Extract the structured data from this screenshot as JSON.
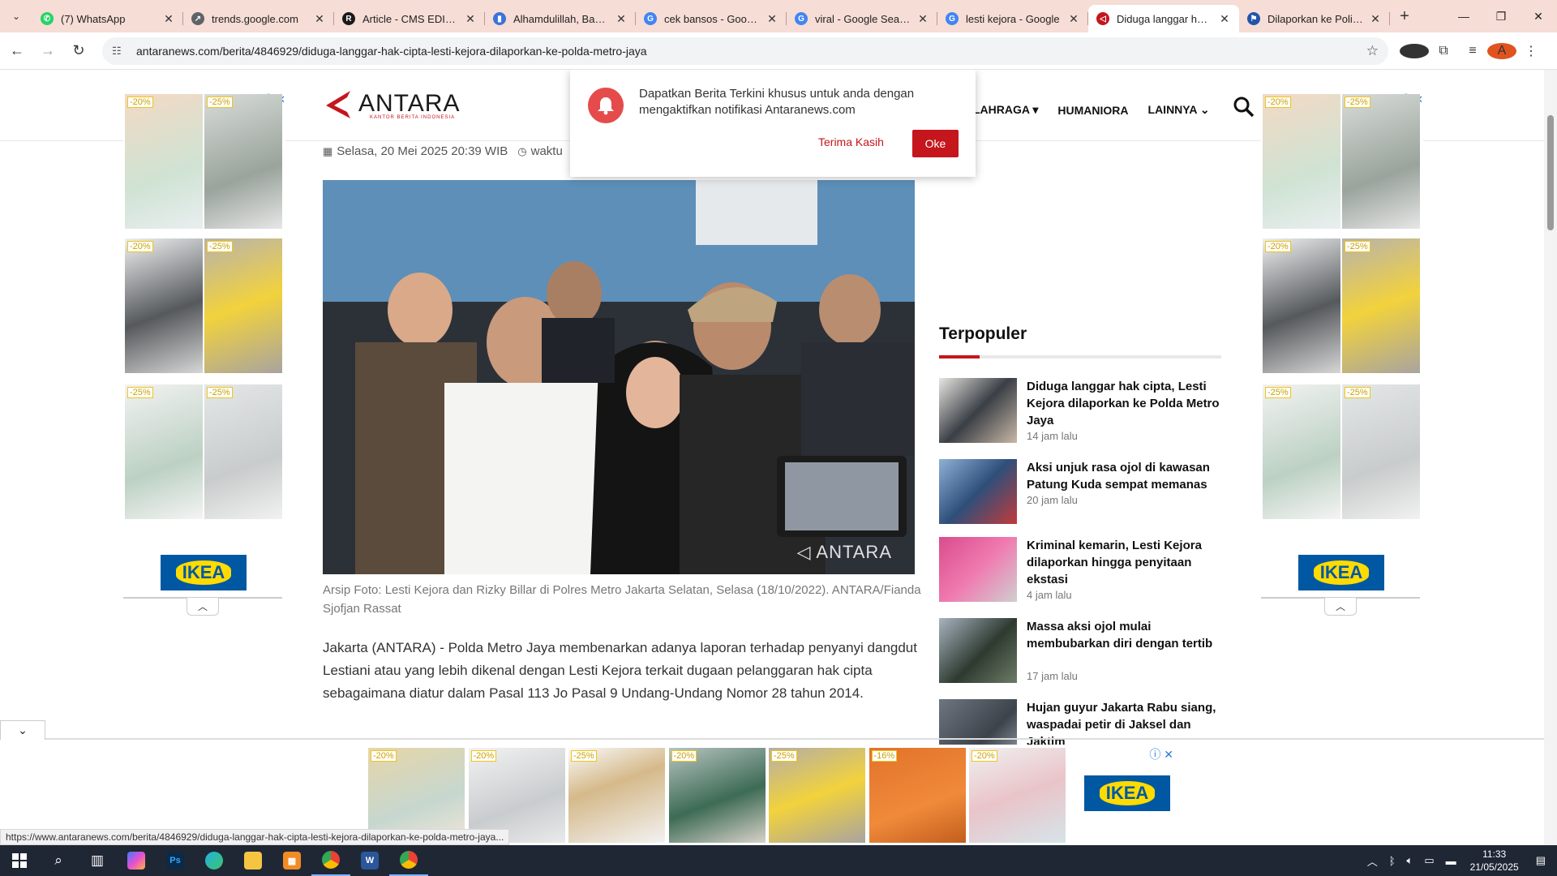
{
  "browser": {
    "tabs": [
      {
        "title": "(7) WhatsApp",
        "color": "#25d366",
        "glyph": "✆"
      },
      {
        "title": "trends.google.com",
        "color": "#5f6368",
        "glyph": "↗"
      },
      {
        "title": "Article - CMS EDITOR",
        "color": "#1a1a1a",
        "glyph": "R"
      },
      {
        "title": "Alhamdulillah, Bansos",
        "color": "#3b73d9",
        "glyph": "▮"
      },
      {
        "title": "cek bansos - Google",
        "color": "#4285f4",
        "glyph": "G"
      },
      {
        "title": "viral - Google Search",
        "color": "#4285f4",
        "glyph": "G"
      },
      {
        "title": "lesti kejora - Google",
        "color": "#4285f4",
        "glyph": "G"
      },
      {
        "title": "Diduga langgar hak c",
        "color": "#c4161c",
        "glyph": "◁"
      },
      {
        "title": "Dilaporkan ke Polisi, I",
        "color": "#2255aa",
        "glyph": "⚑"
      }
    ],
    "url": "antaranews.com/berita/4846929/diduga-langgar-hak-cipta-lesti-kejora-dilaporkan-ke-polda-metro-jaya",
    "status_url": "https://www.antaranews.com/berita/4846929/diduga-langgar-hak-cipta-lesti-kejora-dilaporkan-ke-polda-metro-jaya..."
  },
  "site": {
    "logo_text": "ANTARA",
    "logo_tagline": "KANTOR BERITA INDONESIA",
    "nav": [
      "LAHRAGA",
      "HUMANIORA",
      "LAINNYA"
    ]
  },
  "notification": {
    "message": "Dapatkan Berita Terkini khusus untuk anda dengan mengaktifkan notifikasi Antaranews.com",
    "later_label": "Terima Kasih",
    "ok_label": "Oke"
  },
  "article": {
    "date": "Selasa, 20 Mei 2025 20:39 WIB",
    "reading": "waktu",
    "watermark": "ANTARA",
    "caption": "Arsip Foto: Lesti Kejora dan Rizky Billar di Polres Metro Jakarta Selatan, Selasa (18/10/2022). ANTARA/Fianda Sjofjan Rassat",
    "body": "Jakarta (ANTARA) - Polda Metro Jaya membenarkan adanya laporan terhadap penyanyi dangdut Lestiani atau yang lebih dikenal dengan Lesti Kejora terkait dugaan pelanggaran hak cipta sebagaimana diatur dalam Pasal 113 Jo Pasal 9 Undang-Undang Nomor 28 tahun 2014."
  },
  "popular": {
    "title": "Terpopuler",
    "items": [
      {
        "title": "Diduga langgar hak cipta, Lesti Kejora dilaporkan ke Polda Metro Jaya",
        "time": "14 jam lalu"
      },
      {
        "title": "Aksi unjuk rasa ojol di kawasan Patung Kuda sempat memanas",
        "time": "20 jam lalu"
      },
      {
        "title": "Kriminal kemarin, Lesti Kejora dilaporkan hingga penyitaan ekstasi",
        "time": "4 jam lalu"
      },
      {
        "title": "Massa aksi ojol mulai membubarkan diri dengan tertib",
        "time": "17 jam lalu"
      },
      {
        "title": "Hujan guyur Jakarta Rabu siang, waspadai petir di Jaksel dan Jaktim",
        "time": ""
      }
    ]
  },
  "ads": {
    "brand": "IKEA",
    "side_badges": [
      "-20%",
      "-25%",
      "-20%",
      "-25%",
      "-25%",
      "-25%"
    ],
    "bottom_badges": [
      "-20%",
      "-20%",
      "-25%",
      "-20%",
      "-25%",
      "-16%",
      "-20%"
    ]
  },
  "taskbar": {
    "time": "11:33",
    "date": "21/05/2025"
  }
}
